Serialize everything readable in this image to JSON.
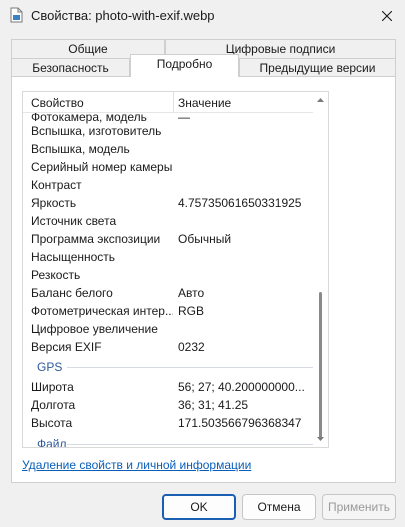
{
  "window": {
    "title": "Свойства: photo-with-exif.webp",
    "icon": "file-icon"
  },
  "tabs_back": [
    {
      "label": "Общие"
    },
    {
      "label": "Цифровые подписи"
    }
  ],
  "tabs_front": [
    {
      "label": "Безопасность"
    },
    {
      "label": "Подробно"
    },
    {
      "label": "Предыдущие версии"
    }
  ],
  "active_tab": "Подробно",
  "list": {
    "columns": {
      "property": "Свойство",
      "value": "Значение"
    },
    "rows": [
      {
        "name": "Вспышка, изготовитель",
        "value": ""
      },
      {
        "name": "Вспышка, модель",
        "value": ""
      },
      {
        "name": "Серийный номер камеры",
        "value": ""
      },
      {
        "name": "Контраст",
        "value": ""
      },
      {
        "name": "Яркость",
        "value": "4.75735061650331925"
      },
      {
        "name": "Источник света",
        "value": ""
      },
      {
        "name": "Программа экспозиции",
        "value": "Обычный"
      },
      {
        "name": "Насыщенность",
        "value": ""
      },
      {
        "name": "Резкость",
        "value": ""
      },
      {
        "name": "Баланс белого",
        "value": "Авто"
      },
      {
        "name": "Фотометрическая интер...",
        "value": "RGB"
      },
      {
        "name": "Цифровое увеличение",
        "value": ""
      },
      {
        "name": "Версия EXIF",
        "value": "0232"
      }
    ],
    "group_gps": "GPS",
    "gps_rows": [
      {
        "name": "Широта",
        "value": "56; 27; 40.200000000..."
      },
      {
        "name": "Долгота",
        "value": "36; 31; 41.25"
      },
      {
        "name": "Высота",
        "value": "171.503566796368347"
      }
    ],
    "group_file": "Файл"
  },
  "link": "Удаление свойств и личной информации",
  "buttons": {
    "ok": "OK",
    "cancel": "Отмена",
    "apply": "Применить"
  },
  "colors": {
    "accent": "#1a5fb4",
    "link": "#0a5eb8",
    "group": "#2d5a9b"
  }
}
